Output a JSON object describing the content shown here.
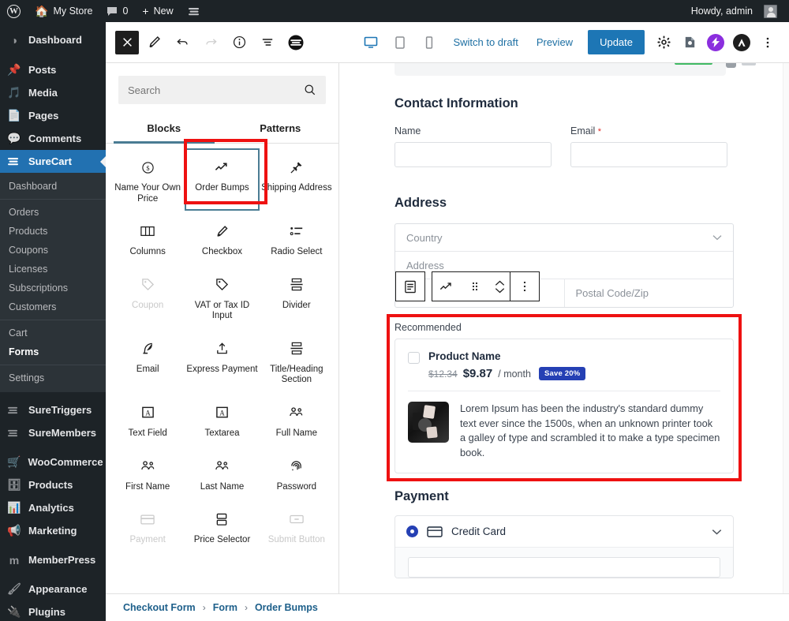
{
  "adminbar": {
    "logo_icon": "wordpress-logo-icon",
    "site_name": "My Store",
    "comments_count": "0",
    "new_label": "New",
    "surecart_icon": "surecart-icon",
    "howdy": "Howdy, admin"
  },
  "wpmenu": {
    "items": [
      {
        "label": "Dashboard",
        "icon": "dashboard-icon"
      },
      {
        "label": "Posts",
        "icon": "pin-icon"
      },
      {
        "label": "Media",
        "icon": "media-icon"
      },
      {
        "label": "Pages",
        "icon": "pages-icon"
      },
      {
        "label": "Comments",
        "icon": "comment-icon"
      },
      {
        "label": "SureCart",
        "icon": "surecart-icon"
      }
    ],
    "submenu_group1": [
      "Dashboard"
    ],
    "submenu_group2": [
      "Orders",
      "Products",
      "Coupons",
      "Licenses",
      "Subscriptions",
      "Customers"
    ],
    "submenu_group3": [
      "Cart",
      "Forms"
    ],
    "submenu_group4": [
      "Settings"
    ],
    "items_after": [
      {
        "label": "SureTriggers",
        "icon": "suretriggers-icon"
      },
      {
        "label": "SureMembers",
        "icon": "suremembers-icon"
      },
      {
        "label": "WooCommerce",
        "icon": "woocommerce-icon"
      },
      {
        "label": "Products",
        "icon": "products-icon"
      },
      {
        "label": "Analytics",
        "icon": "analytics-icon"
      },
      {
        "label": "Marketing",
        "icon": "megaphone-icon"
      },
      {
        "label": "MemberPress",
        "icon": "memberpress-icon"
      },
      {
        "label": "Appearance",
        "icon": "brush-icon"
      },
      {
        "label": "Plugins",
        "icon": "plug-icon"
      }
    ],
    "active_item": "SureCart",
    "active_subitem": "Forms",
    "accent_color": "#2271b1"
  },
  "editor_header": {
    "close_icon": "close-icon",
    "edit_icon": "pencil-icon",
    "undo_icon": "undo-icon",
    "redo_icon": "redo-icon",
    "info_icon": "info-icon",
    "list_view_icon": "list-view-icon",
    "surecart_icon": "surecart-logo-icon",
    "device_desktop_icon": "desktop-icon",
    "device_tablet_icon": "tablet-icon",
    "device_mobile_icon": "mobile-icon",
    "switch_to_draft": "Switch to draft",
    "preview": "Preview",
    "update": "Update",
    "settings_icon": "gear-icon",
    "plugin_icon": "plugin-icon",
    "surerank_icon": "surerank-icon",
    "astra_icon": "astra-icon",
    "more_icon": "more-options-icon",
    "update_color": "#1d76b5"
  },
  "inserter": {
    "search_placeholder": "Search",
    "search_icon": "search-icon",
    "tabs": [
      {
        "label": "Blocks",
        "active": true
      },
      {
        "label": "Patterns",
        "active": false
      }
    ],
    "blocks": [
      {
        "label": "Name Your Own Price",
        "icon": "dollar-circle-icon",
        "disabled": false,
        "selected": false
      },
      {
        "label": "Order Bumps",
        "icon": "trend-up-icon",
        "disabled": false,
        "selected": true
      },
      {
        "label": "Shipping Address",
        "icon": "pin-icon",
        "disabled": false,
        "selected": false
      },
      {
        "label": "Columns",
        "icon": "columns-icon",
        "disabled": false,
        "selected": false
      },
      {
        "label": "Checkbox",
        "icon": "pencil-icon",
        "disabled": false,
        "selected": false
      },
      {
        "label": "Radio Select",
        "icon": "radio-list-icon",
        "disabled": false,
        "selected": false
      },
      {
        "label": "Coupon",
        "icon": "tag-icon",
        "disabled": true,
        "selected": false
      },
      {
        "label": "VAT or Tax ID Input",
        "icon": "tag-icon",
        "disabled": false,
        "selected": false
      },
      {
        "label": "Divider",
        "icon": "divider-icon",
        "disabled": false,
        "selected": false
      },
      {
        "label": "Email",
        "icon": "feather-icon",
        "disabled": false,
        "selected": false
      },
      {
        "label": "Express Payment",
        "icon": "upload-icon",
        "disabled": false,
        "selected": false
      },
      {
        "label": "Title/Heading Section",
        "icon": "divider-icon",
        "disabled": false,
        "selected": false
      },
      {
        "label": "Text Field",
        "icon": "text-field-icon",
        "disabled": false,
        "selected": false
      },
      {
        "label": "Textarea",
        "icon": "textarea-icon",
        "disabled": false,
        "selected": false
      },
      {
        "label": "Full Name",
        "icon": "people-icon",
        "disabled": false,
        "selected": false
      },
      {
        "label": "First Name",
        "icon": "people-icon",
        "disabled": false,
        "selected": false
      },
      {
        "label": "Last Name",
        "icon": "people-icon",
        "disabled": false,
        "selected": false
      },
      {
        "label": "Password",
        "icon": "fingerprint-icon",
        "disabled": false,
        "selected": false
      },
      {
        "label": "Payment",
        "icon": "card-icon",
        "disabled": true,
        "selected": false
      },
      {
        "label": "Price Selector",
        "icon": "price-selector-icon",
        "disabled": false,
        "selected": false
      },
      {
        "label": "Submit Button",
        "icon": "submit-button-icon",
        "disabled": true,
        "selected": false
      }
    ],
    "highlight_color": "#ee1111",
    "selected_outline_color": "#4a7c93"
  },
  "canvas": {
    "contact_section": {
      "title": "Contact Information",
      "fields": [
        {
          "label": "Name",
          "required": false,
          "value": "",
          "placeholder": ""
        },
        {
          "label": "Email",
          "required": true,
          "value": "",
          "placeholder": ""
        }
      ],
      "required_marker": "*"
    },
    "address_section": {
      "title": "Address",
      "country_placeholder": "Country",
      "address_placeholder": "Address",
      "city_placeholder": "",
      "postal_placeholder": "Postal Code/Zip",
      "chevron_icon": "chevron-down-icon"
    },
    "block_toolbar": {
      "parent_icon": "parent-block-icon",
      "block_icon": "trend-up-icon",
      "drag_icon": "drag-handle-icon",
      "move_up_icon": "chevron-up-icon",
      "move_down_icon": "chevron-down-icon",
      "options_icon": "more-options-icon"
    },
    "order_bump": {
      "label": "Recommended",
      "checkbox_checked": false,
      "product_name": "Product Name",
      "old_price": "$12.34",
      "new_price": "$9.87",
      "interval": "/ month",
      "save_badge": "Save 20%",
      "badge_color": "#2540b4",
      "description": "Lorem Ipsum has been the industry's standard dummy text ever since the 1500s, when an unknown printer took a galley of type and scrambled it to make a type specimen book.",
      "thumbnail_icon": "product-image-icon",
      "highlight_color": "#ee1111"
    },
    "payment_section": {
      "title": "Payment",
      "method_label": "Credit Card",
      "method_selected": true,
      "card_icon": "credit-card-icon",
      "chevron_icon": "chevron-down-icon",
      "radio_color": "#2540b4"
    }
  },
  "footer": {
    "breadcrumbs": [
      "Checkout Form",
      "Form",
      "Order Bumps"
    ],
    "separator": "›",
    "link_color": "#1d5f8a"
  }
}
